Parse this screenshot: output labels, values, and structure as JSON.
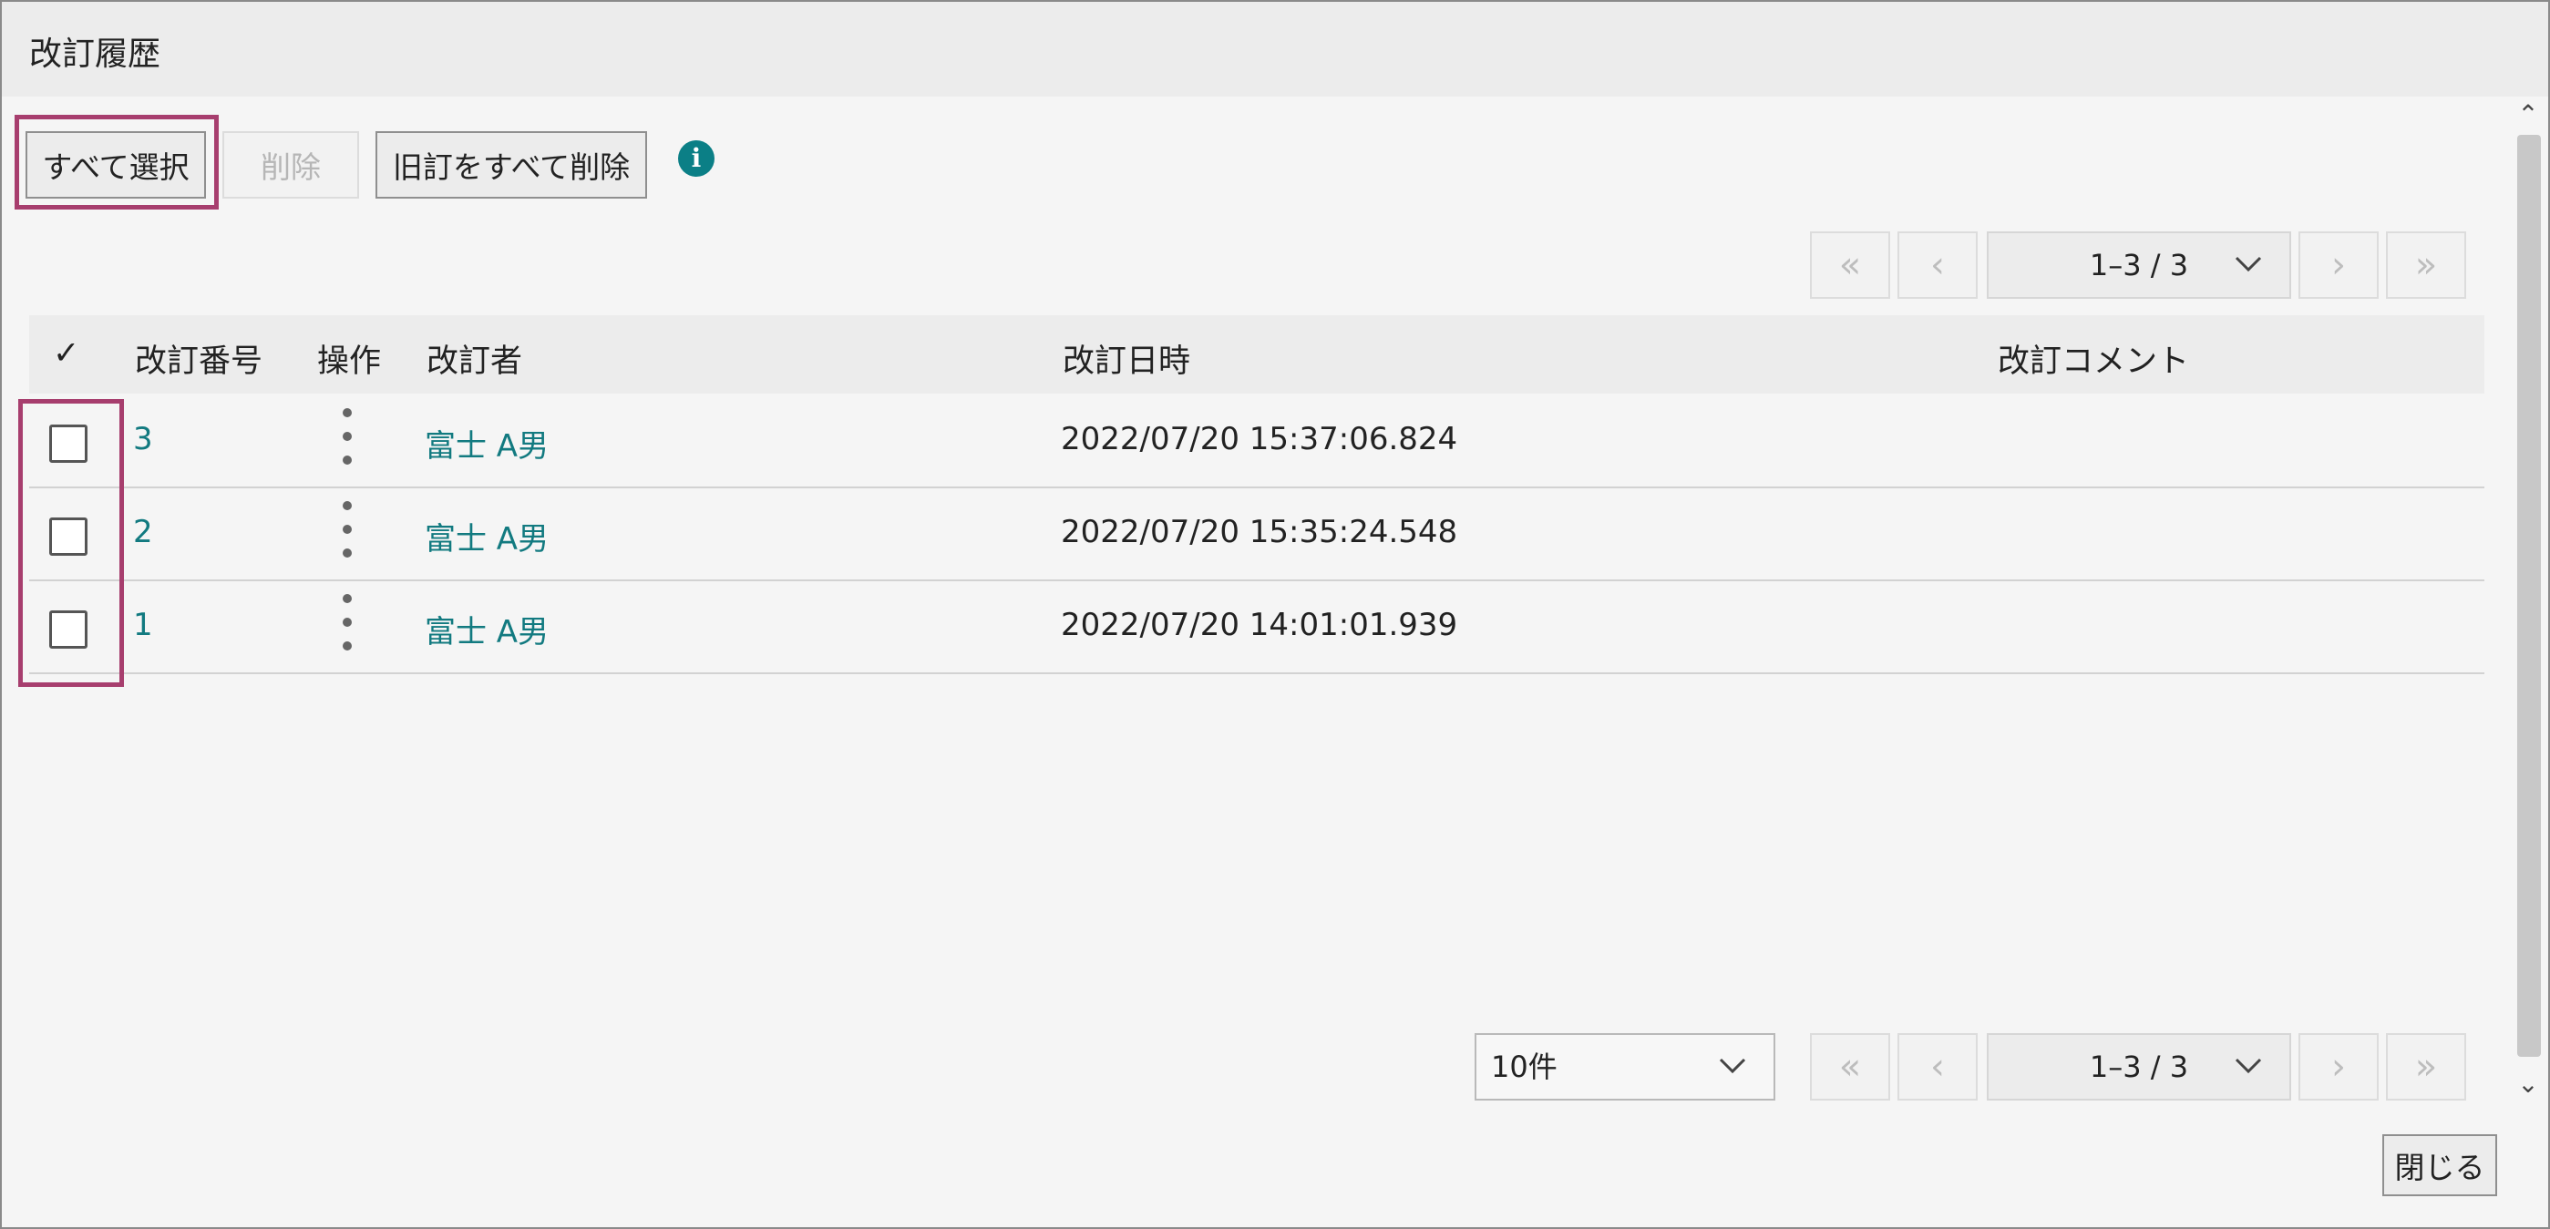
{
  "title": "改訂履歴",
  "toolbar": {
    "select_all": "すべて選択",
    "delete": "削除",
    "delete_old": "旧訂をすべて削除"
  },
  "pager_top": {
    "range": "1–3 / 3"
  },
  "pager_bottom": {
    "range": "1–3 / 3",
    "page_size": "10件"
  },
  "table": {
    "headers": {
      "check": "✓",
      "rev_no": "改訂番号",
      "ops": "操作",
      "author": "改訂者",
      "datetime": "改訂日時",
      "comment": "改訂コメント"
    },
    "rows": [
      {
        "rev_no": "3",
        "author": "富士 A男",
        "datetime": "2022/07/20 15:37:06.824",
        "comment": ""
      },
      {
        "rev_no": "2",
        "author": "富士 A男",
        "datetime": "2022/07/20 15:35:24.548",
        "comment": ""
      },
      {
        "rev_no": "1",
        "author": "富士 A男",
        "datetime": "2022/07/20 14:01:01.939",
        "comment": ""
      }
    ]
  },
  "close": "閉じる",
  "icons": {
    "first": "«",
    "prev": "‹",
    "next": "›",
    "last": "»",
    "info": "i",
    "scroll_up": "⌃",
    "scroll_down": "⌄"
  },
  "colors": {
    "accent": "#127a80",
    "highlight": "#a73e6e",
    "info": "#0b7f86"
  }
}
